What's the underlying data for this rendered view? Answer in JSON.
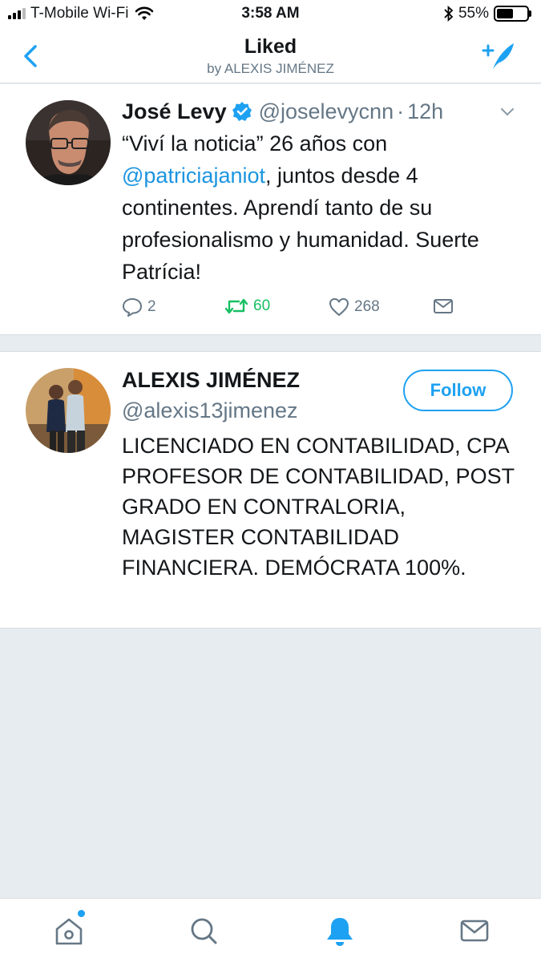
{
  "status_bar": {
    "carrier": "T-Mobile Wi-Fi",
    "time": "3:58 AM",
    "battery_text": "55%",
    "battery_level": 0.55,
    "signal_bars": 3
  },
  "nav": {
    "title": "Liked",
    "subtitle": "by ALEXIS JIMÉNEZ"
  },
  "tweet": {
    "author_name": "José Levy",
    "verified": true,
    "handle": "@joselevycnn",
    "separator": "·",
    "time": "12h",
    "text_before": "“Viví la noticia” 26 años con ",
    "mention": "@patriciajaniot",
    "text_after": ", juntos desde 4 continentes. Aprendí tanto de su profesionalismo y humanidad. Suerte Patrícia!",
    "reply_count": "2",
    "retweet_count": "60",
    "like_count": "268"
  },
  "profile": {
    "name": "ALEXIS JIMÉNEZ",
    "handle": "@alexis13jimenez",
    "follow_label": "Follow",
    "bio": "LICENCIADO EN CONTABILIDAD, CPA PROFESOR DE CONTABILIDAD, POST GRADO EN CONTRALORIA, MAGISTER CONTABILIDAD FINANCIERA. DEMÓCRATA 100%."
  },
  "tabbar": {
    "items": [
      {
        "name": "home-icon",
        "active": false,
        "badge": true
      },
      {
        "name": "search-icon",
        "active": false,
        "badge": false
      },
      {
        "name": "notifications-icon",
        "active": true,
        "badge": false
      },
      {
        "name": "messages-icon",
        "active": false,
        "badge": false
      }
    ]
  },
  "colors": {
    "accent": "#1da1f2",
    "retweet": "#17bf63",
    "muted": "#657786",
    "background": "#e6ecf0"
  }
}
